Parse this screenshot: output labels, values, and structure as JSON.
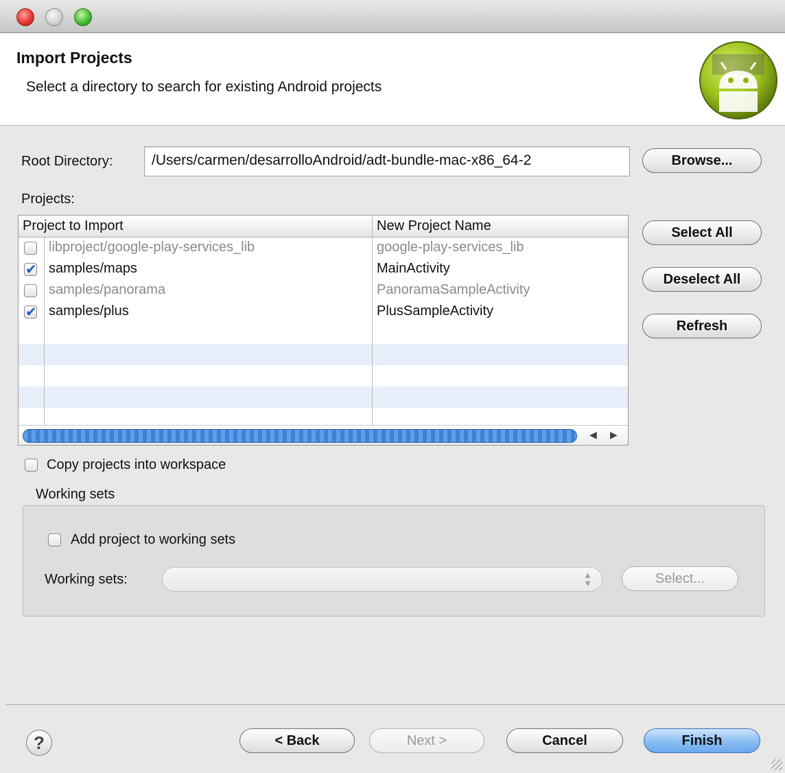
{
  "header": {
    "title": "Import Projects",
    "description": "Select a directory to search for existing Android projects",
    "logo_icon": "android-logo"
  },
  "root_directory": {
    "label": "Root Directory:",
    "value": "/Users/carmen/desarrolloAndroid/adt-bundle-mac-x86_64-2",
    "browse_label": "Browse..."
  },
  "projects": {
    "label": "Projects:",
    "columns": [
      "Project to Import",
      "New Project Name"
    ],
    "rows": [
      {
        "project": "libproject/google-play-services_lib",
        "name": "google-play-services_lib",
        "checked": false,
        "enabled": false
      },
      {
        "project": "samples/maps",
        "name": "MainActivity",
        "checked": true,
        "enabled": true
      },
      {
        "project": "samples/panorama",
        "name": "PanoramaSampleActivity",
        "checked": false,
        "enabled": false
      },
      {
        "project": "samples/plus",
        "name": "PlusSampleActivity",
        "checked": true,
        "enabled": true
      }
    ],
    "select_all_label": "Select All",
    "deselect_all_label": "Deselect All",
    "refresh_label": "Refresh"
  },
  "copy_projects": {
    "label": "Copy projects into workspace",
    "checked": false
  },
  "working_sets": {
    "group_label": "Working sets",
    "add_label": "Add project to working sets",
    "add_checked": false,
    "combo_label": "Working sets:",
    "combo_value": "",
    "select_label": "Select..."
  },
  "footer": {
    "back_label": "< Back",
    "next_label": "Next >",
    "cancel_label": "Cancel",
    "finish_label": "Finish",
    "help_icon": "help-icon"
  },
  "colors": {
    "default_button": "#6aa8ec",
    "row_alt": "#e8eef9",
    "checkbox_check": "#1d5fbf"
  }
}
